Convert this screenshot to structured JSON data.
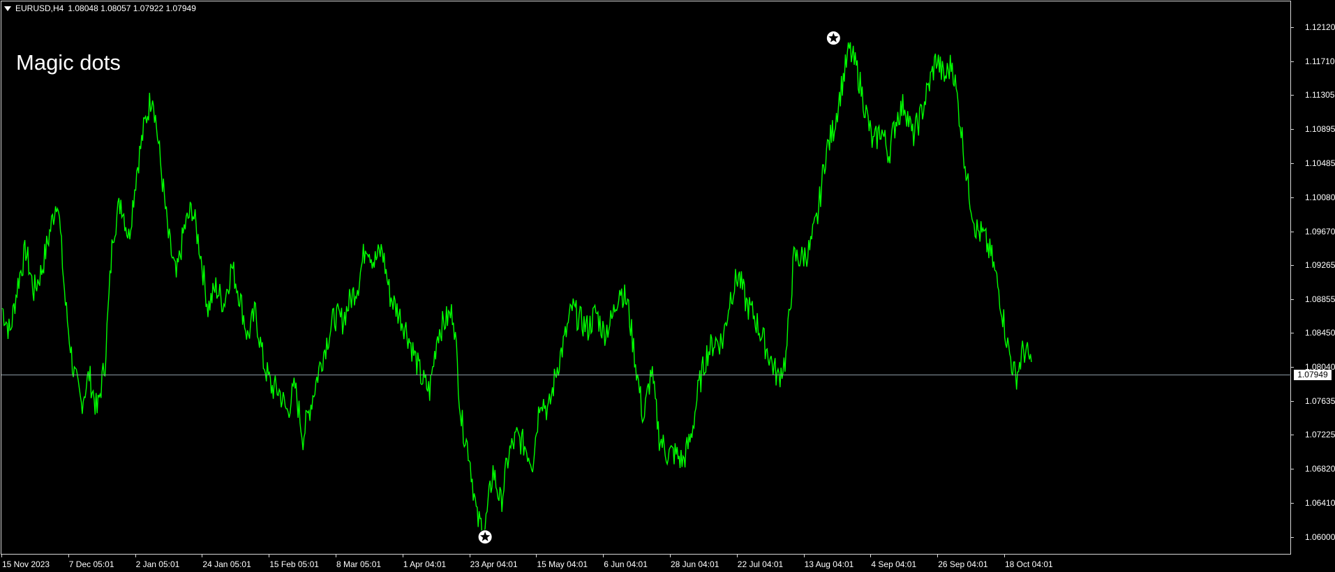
{
  "header": {
    "symbol": "EURUSD,H4",
    "ohlc": "1.08048 1.08057 1.07922 1.07949",
    "dropdown_icon": "triangle-down-icon"
  },
  "indicator": {
    "title": "Magic dots"
  },
  "current_price": "1.07949",
  "colors": {
    "background": "#000000",
    "series": "#00ff00",
    "price_line": "#8c9aa4",
    "text": "#ffffff"
  },
  "chart_data": {
    "type": "line",
    "title": "",
    "xlabel": "",
    "ylabel": "",
    "ylim": [
      1.0583,
      1.1238
    ],
    "grid": false,
    "y_ticks": [
      "1.12120",
      "1.11710",
      "1.11305",
      "1.10895",
      "1.10485",
      "1.10080",
      "1.09670",
      "1.09265",
      "1.08855",
      "1.08450",
      "1.08040",
      "1.07635",
      "1.07225",
      "1.06820",
      "1.06410",
      "1.06000"
    ],
    "x_ticks": [
      "15 Nov 2023",
      "7 Dec 05:01",
      "2 Jan 05:01",
      "24 Jan 05:01",
      "15 Feb 05:01",
      "8 Mar 05:01",
      "1 Apr 04:01",
      "23 Apr 04:01",
      "15 May 04:01",
      "6 Jun 04:01",
      "28 Jun 04:01",
      "22 Jul 04:01",
      "13 Aug 04:01",
      "4 Sep 04:01",
      "26 Sep 04:01",
      "18 Oct 04:01"
    ],
    "series": [
      {
        "values": [
          1.0875,
          1.0845,
          1.0905,
          1.0945,
          1.0895,
          1.092,
          1.0965,
          1.101,
          1.088,
          1.08,
          1.076,
          1.0795,
          1.075,
          1.081,
          1.0965,
          1.1005,
          1.096,
          1.104,
          1.1095,
          1.1135,
          1.105,
          1.096,
          1.091,
          1.097,
          1.0995,
          1.0945,
          1.0875,
          1.09,
          1.088,
          1.0925,
          1.089,
          1.084,
          1.087,
          1.081,
          1.078,
          1.0775,
          1.075,
          1.078,
          1.072,
          1.076,
          1.08,
          1.0835,
          1.0865,
          1.086,
          1.0885,
          1.0905,
          1.0955,
          1.093,
          1.0945,
          1.089,
          1.087,
          1.085,
          1.082,
          1.079,
          1.0775,
          1.0845,
          1.086,
          1.087,
          1.074,
          1.07,
          1.062,
          1.061,
          1.068,
          1.064,
          1.07,
          1.072,
          1.071,
          1.069,
          1.077,
          1.075,
          1.08,
          1.0835,
          1.0875,
          1.086,
          1.085,
          1.087,
          1.0845,
          1.086,
          1.09,
          1.088,
          1.081,
          1.074,
          1.08,
          1.072,
          1.07,
          1.07,
          1.069,
          1.072,
          1.078,
          1.082,
          1.0835,
          1.0835,
          1.089,
          1.0915,
          1.088,
          1.0865,
          1.084,
          1.0815,
          1.079,
          1.0815,
          1.0935,
          1.0935,
          1.0945,
          1.0985,
          1.106,
          1.109,
          1.114,
          1.1185,
          1.116,
          1.1115,
          1.107,
          1.109,
          1.106,
          1.1105,
          1.112,
          1.108,
          1.1105,
          1.114,
          1.1175,
          1.115,
          1.117,
          1.11,
          1.102,
          1.097,
          1.096,
          1.0935,
          1.089,
          1.083,
          1.079,
          1.0825,
          1.081
        ]
      }
    ],
    "markers": [
      {
        "label": "Magic dot high",
        "x_index": 105,
        "value": 1.1199,
        "icon": "star-icon"
      },
      {
        "label": "Magic dot low",
        "x_index": 61,
        "value": 1.06,
        "icon": "star-icon"
      }
    ]
  }
}
